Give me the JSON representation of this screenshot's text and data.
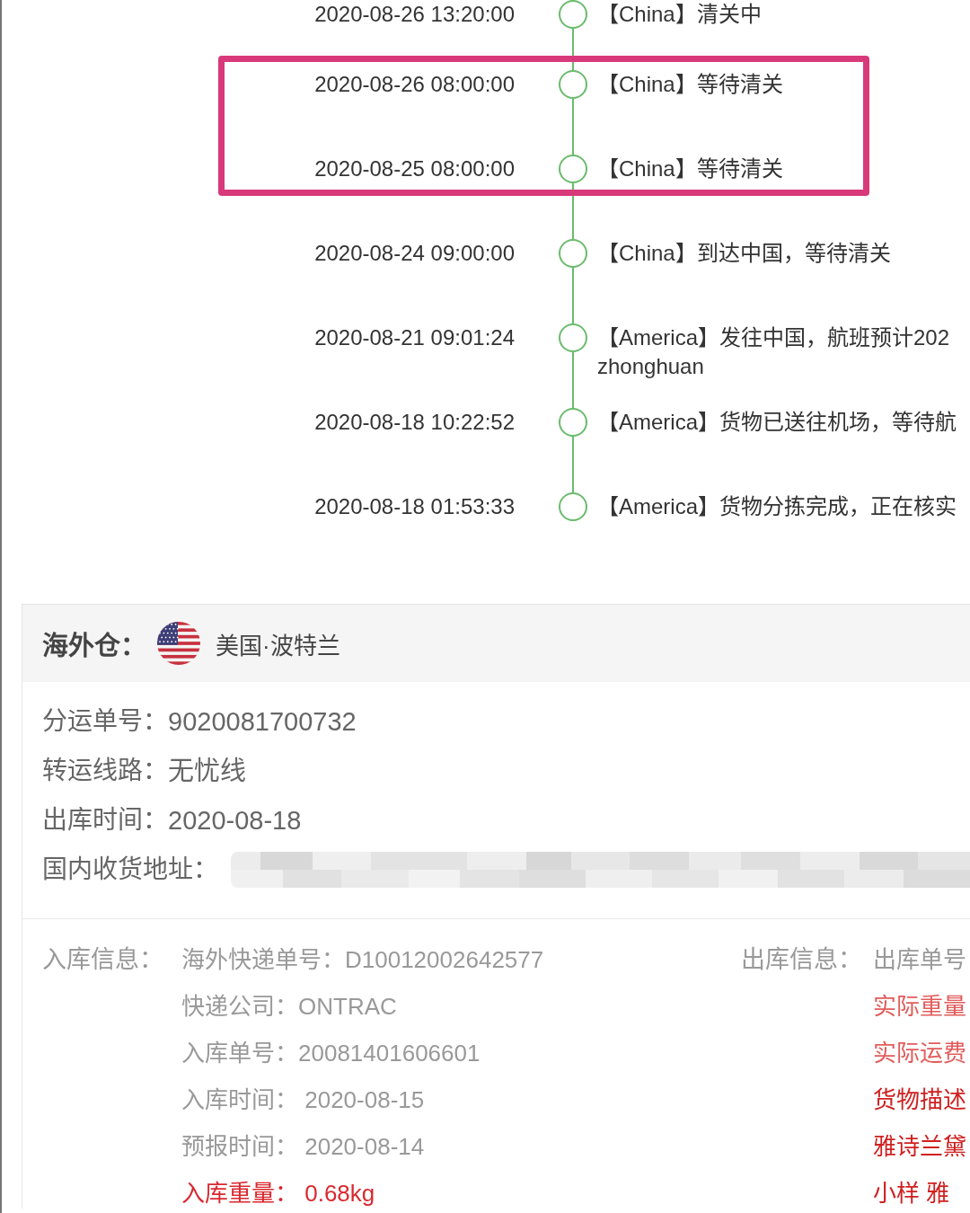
{
  "timeline": {
    "events": [
      {
        "time": "2020-08-26 13:20:00",
        "lines": [
          "【China】清关中"
        ],
        "highlighted": false
      },
      {
        "time": "2020-08-26 08:00:00",
        "lines": [
          "【China】等待清关"
        ],
        "highlighted": true
      },
      {
        "time": "2020-08-25 08:00:00",
        "lines": [
          "【China】等待清关"
        ],
        "highlighted": true
      },
      {
        "time": "2020-08-24 09:00:00",
        "lines": [
          "【China】到达中国，等待清关"
        ],
        "highlighted": false
      },
      {
        "time": "2020-08-21 09:01:24",
        "lines": [
          "【America】发往中国，航班预计202",
          "zhonghuan"
        ],
        "highlighted": false
      },
      {
        "time": "2020-08-18 10:22:52",
        "lines": [
          "【America】货物已送往机场，等待航"
        ],
        "highlighted": false
      },
      {
        "time": "2020-08-18 01:53:33",
        "lines": [
          "【America】货物分拣完成，正在核实"
        ],
        "highlighted": false
      }
    ]
  },
  "warehouse": {
    "title": "海外仓：",
    "location": "美国·波特兰",
    "fields": [
      {
        "label": "分运单号：",
        "value": "9020081700732",
        "blurred": false
      },
      {
        "label": "转运线路：",
        "value": "无忧线",
        "blurred": false
      },
      {
        "label": "出库时间：",
        "value": "2020-08-18",
        "blurred": false
      },
      {
        "label": "国内收货地址：",
        "blurred": true
      }
    ],
    "inbound": {
      "label": "入库信息：",
      "lines": [
        {
          "text": "海外快递单号：D10012002642577",
          "color": "#999999"
        },
        {
          "text": "快递公司：ONTRAC",
          "color": "#999999"
        },
        {
          "text": "入库单号：20081401606601",
          "color": "#999999"
        },
        {
          "text": "入库时间： 2020-08-15",
          "color": "#999999"
        },
        {
          "text": "预报时间： 2020-08-14",
          "color": "#999999"
        },
        {
          "text": "入库重量： 0.68kg",
          "color": "#d9282f"
        }
      ]
    },
    "outbound": {
      "label": "出库信息：",
      "lines": [
        {
          "text": "出库单号",
          "color": "#999999"
        },
        {
          "text": "实际重量",
          "color": "#e25c5c"
        },
        {
          "text": "实际运费",
          "color": "#e25c5c"
        },
        {
          "text": "货物描述",
          "color": "#cf2020"
        },
        {
          "text": "雅诗兰黛",
          "color": "#cf2020"
        },
        {
          "text": "小样 雅",
          "color": "#cf2020"
        }
      ]
    }
  }
}
